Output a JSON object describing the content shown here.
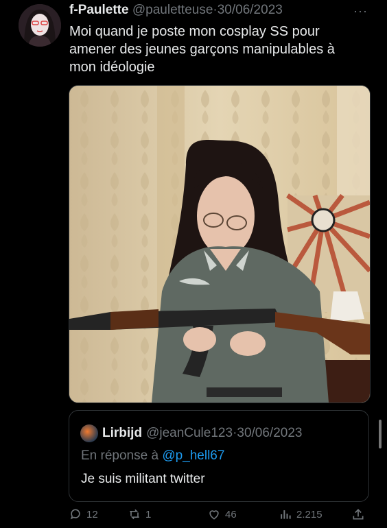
{
  "tweet": {
    "author_name": "f-Paulette",
    "handle": "@pauletteuse",
    "separator": "·",
    "date": "30/06/2023",
    "more": "···",
    "text": "Moi quand je poste mon cosplay SS pour amener des jeunes garçons manipulables à mon idéologie"
  },
  "quote": {
    "author_name": "Lirbijd",
    "handle": "@jeanCule123",
    "separator": "·",
    "date": "30/06/2023",
    "reply_prefix": "En réponse à",
    "reply_mention": "@p_hell67",
    "text": "Je suis militant twitter"
  },
  "actions": {
    "replies": "12",
    "retweets": "1",
    "likes": "46",
    "views": "2.215"
  },
  "icons": [
    "more-icon",
    "reply-icon",
    "retweet-icon",
    "like-icon",
    "views-icon",
    "share-icon"
  ],
  "colors": {
    "background": "#000000",
    "text": "#e7e9ea",
    "secondary": "#71767b",
    "link": "#1d9bf0",
    "border": "#2f3336"
  }
}
